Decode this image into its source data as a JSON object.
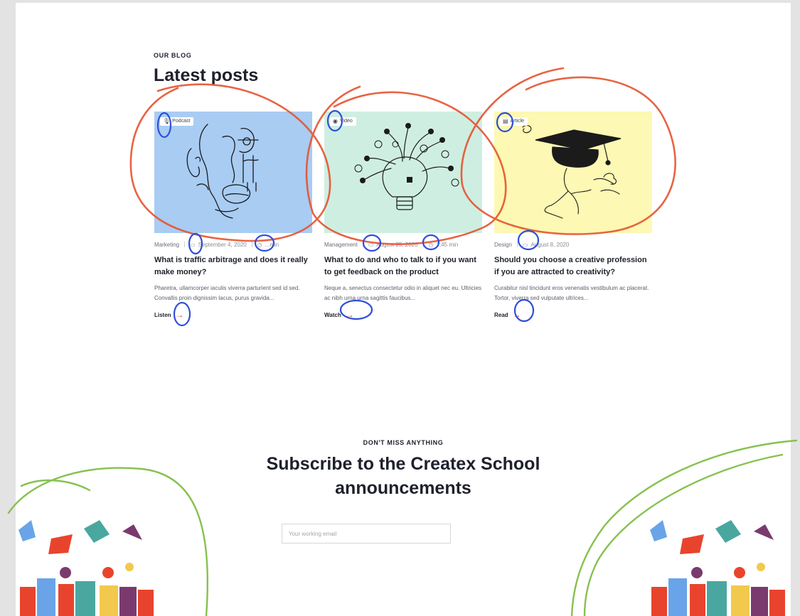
{
  "blog": {
    "eyebrow": "OUR BLOG",
    "heading": "Latest posts",
    "posts": [
      {
        "tag": "Podcast",
        "tag_icon": "microphone-icon",
        "category": "Marketing",
        "date": "September 4, 2020",
        "duration": "...min",
        "title": "What is traffic arbitrage and does it really make money?",
        "excerpt": "Pharetra, ullamcorper iaculis viverra parturient sed id sed. Convallis proin dignissim lacus, purus gravida...",
        "action": "Listen",
        "image_bg": "#a9ccf3"
      },
      {
        "tag": "Video",
        "tag_icon": "play-icon",
        "category": "Management",
        "date": "August 25, 2020",
        "duration": "1:45 min",
        "title": "What to do and who to talk to if you want to get feedback on the product",
        "excerpt": "Neque a, senectus consectetur odio in aliquet nec eu. Ultricies ac nibh urna urna sagittis faucibus...",
        "action": "Watch",
        "image_bg": "#cfeee2"
      },
      {
        "tag": "Article",
        "tag_icon": "document-icon",
        "category": "Design",
        "date": "August 8, 2020",
        "title": "Should you choose a creative profession if you are attracted to creativity?",
        "excerpt": "Curabitur nisl tincidunt eros venenatis vestibulum ac placerat. Tortor, viverra sed vulputate ultrices...",
        "action": "Read",
        "image_bg": "#fdf8b3"
      }
    ]
  },
  "subscribe": {
    "eyebrow": "DON'T MISS ANYTHING",
    "heading_line1": "Subscribe to the Createx School",
    "heading_line2": "announcements",
    "email_placeholder": "Your working email"
  },
  "colors": {
    "accent": "#e8442d",
    "text": "#1e212c",
    "annotation_red": "#e5532f",
    "annotation_blue": "#2e4fd8",
    "annotation_green": "#86c14f"
  }
}
